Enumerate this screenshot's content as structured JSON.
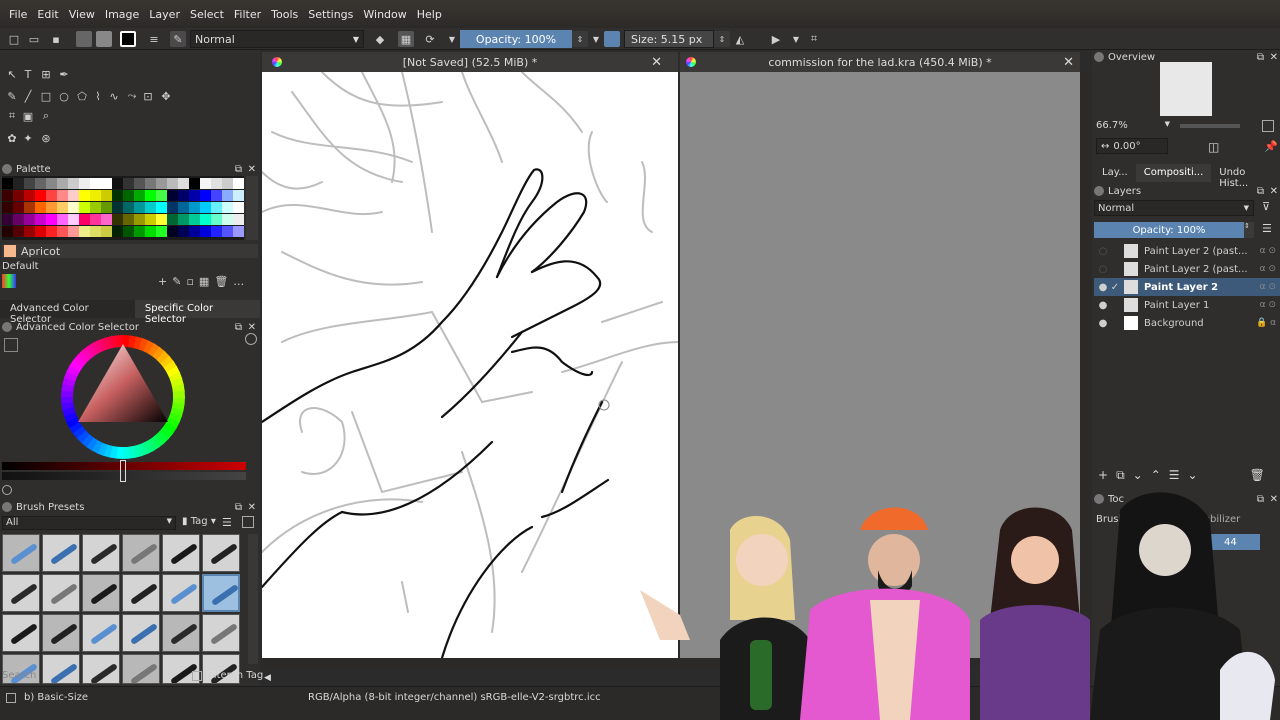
{
  "menu": [
    "File",
    "Edit",
    "View",
    "Image",
    "Layer",
    "Select",
    "Filter",
    "Tools",
    "Settings",
    "Window",
    "Help"
  ],
  "toolbar": {
    "blend_mode": "Normal",
    "opacity_label": "Opacity: 100%",
    "size_label": "Size: 5.15 px"
  },
  "tabs": [
    {
      "title": "[Not Saved]  (52.5 MiB) *"
    },
    {
      "title": "commission for the lad.kra (450.4 MiB) *"
    }
  ],
  "left": {
    "palette_title": "Palette",
    "color_name": "Apricot",
    "palette_set": "Default",
    "selector_tabs": [
      "Advanced Color Selector",
      "Specific Color Selector"
    ],
    "adv_selector_title": "Advanced Color Selector",
    "brush_presets_title": "Brush Presets",
    "brush_filter": "All",
    "tag_label": "Tag",
    "search_placeholder": "Search",
    "filter_in_tag": "Filter in Tag"
  },
  "right": {
    "overview_title": "Overview",
    "zoom": "66.7%",
    "rotation": "0.00°",
    "dock_tabs": [
      "Lay...",
      "Compositi...",
      "Undo Hist..."
    ],
    "layers_title": "Layers",
    "layer_blend": "Normal",
    "layer_opacity": "Opacity:  100%",
    "layers": [
      {
        "name": "Paint Layer 2 (past...",
        "visible": false,
        "selected": false
      },
      {
        "name": "Paint Layer 2 (past...",
        "visible": false,
        "selected": false
      },
      {
        "name": "Paint Layer 2",
        "visible": true,
        "selected": true
      },
      {
        "name": "Paint Layer 1",
        "visible": true,
        "selected": false
      },
      {
        "name": "Background",
        "visible": true,
        "selected": false
      }
    ],
    "tool_options_title": "Toc",
    "brush_label": "Brush",
    "stabilizer_label": "tabilizer",
    "stabilizer_value": "44"
  },
  "status": {
    "color_profile": "RGB/Alpha (8-bit integer/channel)  sRGB-elle-V2-srgbtrc.icc",
    "brush_name": "b) Basic-Size"
  },
  "colors": {
    "accent": "#5b84b1",
    "panel_bg": "#302e2c",
    "canvas_bg": "#ffffff"
  }
}
